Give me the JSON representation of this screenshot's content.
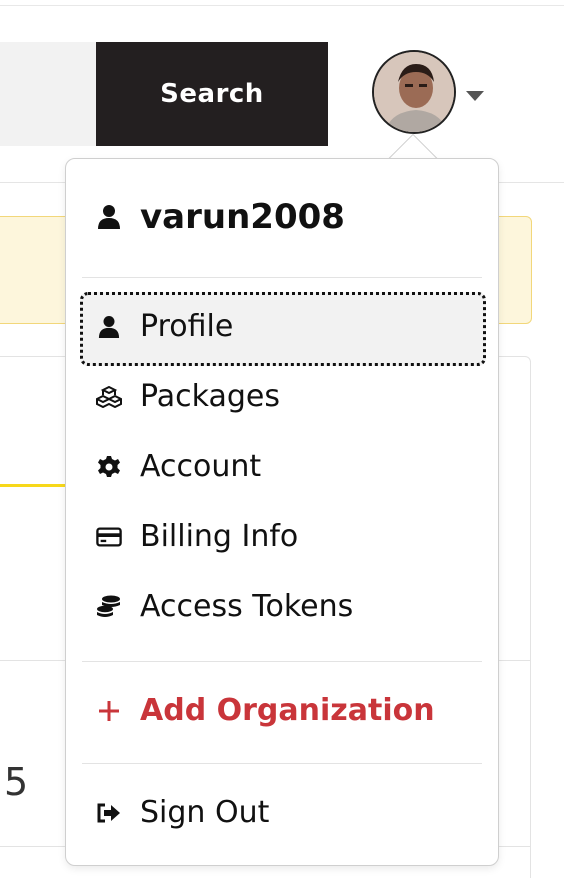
{
  "header": {
    "search_button": "Search",
    "avatar_icon": "user-avatar",
    "caret_icon": "caret-down-icon"
  },
  "background": {
    "number_fragment": "5"
  },
  "dropdown": {
    "username": "varun2008",
    "items": [
      {
        "label": "Profile",
        "icon": "user-icon"
      },
      {
        "label": "Packages",
        "icon": "cubes-icon"
      },
      {
        "label": "Account",
        "icon": "gear-icon"
      },
      {
        "label": "Billing Info",
        "icon": "credit-card-icon"
      },
      {
        "label": "Access Tokens",
        "icon": "coins-icon"
      }
    ],
    "add_organization": "Add Organization",
    "sign_out": "Sign Out"
  },
  "colors": {
    "accent_red": "#c9353a",
    "search_button_bg": "#231f20",
    "alert_bg": "#fdf6dc",
    "alert_border": "#f2d77a",
    "yellow_accent": "#f7d81a"
  }
}
